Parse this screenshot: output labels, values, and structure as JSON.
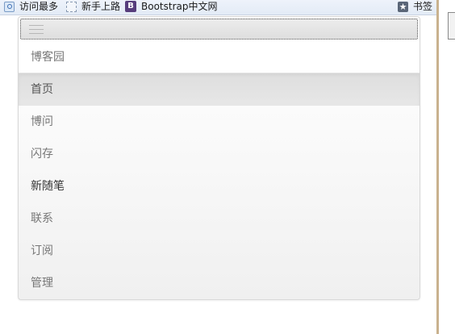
{
  "bookmarks_bar": {
    "items": [
      {
        "label": "访问最多",
        "icon": "most-visited-icon"
      },
      {
        "label": "新手上路",
        "icon": "dotted-page-icon"
      },
      {
        "label": "Bootstrap中文网",
        "icon": "bootstrap-logo-icon",
        "icon_text": "B"
      },
      {
        "label": "书签",
        "icon": "bookmark-star-icon",
        "icon_text": "★"
      }
    ]
  },
  "navbar": {
    "brand": "博客园",
    "items": [
      {
        "label": "首页",
        "state": "active"
      },
      {
        "label": "博问",
        "state": "normal"
      },
      {
        "label": "闪存",
        "state": "normal"
      },
      {
        "label": "新随笔",
        "state": "hover"
      },
      {
        "label": "联系",
        "state": "normal"
      },
      {
        "label": "订阅",
        "state": "normal"
      },
      {
        "label": "管理",
        "state": "normal"
      }
    ]
  },
  "colors": {
    "link": "#777777",
    "link_hover": "#333333",
    "active_bg": "#e7e7e7",
    "bootstrap_brand": "#563d7c"
  }
}
